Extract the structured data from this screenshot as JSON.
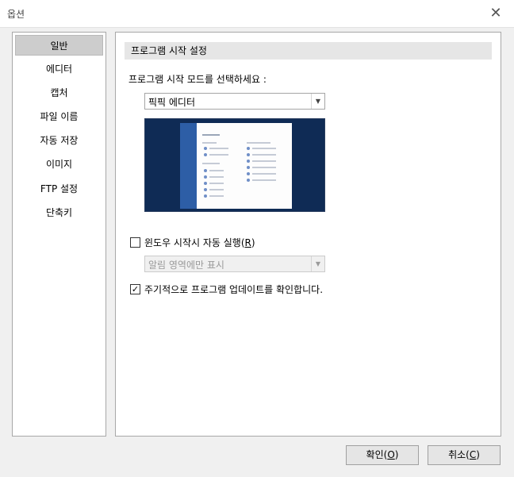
{
  "window": {
    "title": "옵션",
    "close_label": "✕"
  },
  "sidebar": {
    "items": [
      {
        "label": "일반",
        "selected": true
      },
      {
        "label": "에디터",
        "selected": false
      },
      {
        "label": "캡처",
        "selected": false
      },
      {
        "label": "파일 이름",
        "selected": false
      },
      {
        "label": "자동 저장",
        "selected": false
      },
      {
        "label": "이미지",
        "selected": false
      },
      {
        "label": "FTP 설정",
        "selected": false
      },
      {
        "label": "단축키",
        "selected": false
      }
    ]
  },
  "main": {
    "section_title": "프로그램 시작 설정",
    "mode_label": "프로그램 시작 모드를 선택하세요 :",
    "mode_select": {
      "value": "픽픽 에디터",
      "arrow": "▼"
    },
    "autostart": {
      "label_prefix": "윈도우 시작시 자동 실행(",
      "accel": "R",
      "label_suffix": ")",
      "checked": false
    },
    "tray_select": {
      "value": "알림 영역에만 표시",
      "arrow": "▼",
      "disabled": true
    },
    "update_check": {
      "label": "주기적으로 프로그램 업데이트를 확인합니다.",
      "checked": true,
      "mark": "✓"
    }
  },
  "buttons": {
    "ok": {
      "prefix": "확인(",
      "accel": "O",
      "suffix": ")"
    },
    "cancel": {
      "prefix": "취소(",
      "accel": "C",
      "suffix": ")"
    }
  }
}
